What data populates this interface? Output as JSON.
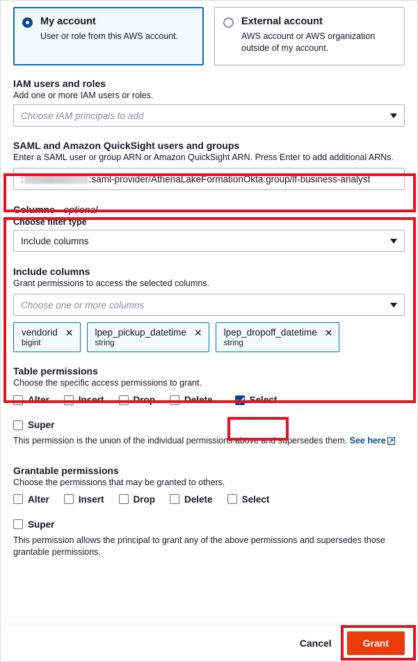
{
  "account_type": {
    "my_account": {
      "title": "My account",
      "description": "User or role from this AWS account.",
      "selected": true
    },
    "external_account": {
      "title": "External account",
      "description": "AWS account or AWS organization outside of my account.",
      "selected": false
    }
  },
  "iam": {
    "label": "IAM users and roles",
    "hint": "Add one or more IAM users or roles.",
    "placeholder": "Choose IAM principals to add"
  },
  "saml": {
    "label": "SAML and Amazon QuickSight users and groups",
    "hint": "Enter a SAML user or group ARN or Amazon QuickSight ARN. Press Enter to add additional ARNs.",
    "arn_prefix": ":",
    "arn_suffix": ":saml-provider/AthenaLakeFormationOkta:group/lf-business-analyst"
  },
  "columns": {
    "label": "Columns - ",
    "label_optional": "optional",
    "filter_type_label": "Choose filter type",
    "filter_type_value": "Include columns",
    "include_label": "Include columns",
    "include_hint": "Grant permissions to access the selected columns.",
    "include_placeholder": "Choose one or more columns",
    "chips": [
      {
        "name": "vendorid",
        "type": "bigint",
        "remove_icon": "✕"
      },
      {
        "name": "lpep_pickup_datetime",
        "type": "string",
        "remove_icon": "✕"
      },
      {
        "name": "lpep_dropoff_datetime",
        "type": "string",
        "remove_icon": "✕"
      }
    ]
  },
  "table_permissions": {
    "label": "Table permissions",
    "hint": "Choose the specific access permissions to grant.",
    "options": [
      {
        "label": "Alter",
        "checked": false
      },
      {
        "label": "Insert",
        "checked": false
      },
      {
        "label": "Drop",
        "checked": false
      },
      {
        "label": "Delete",
        "checked": false
      },
      {
        "label": "Select",
        "checked": true
      }
    ],
    "super": {
      "label": "Super",
      "checked": false
    },
    "super_note": "This permission is the union of the individual permissions above and supersedes them.",
    "super_link": "See here"
  },
  "grantable_permissions": {
    "label": "Grantable permissions",
    "hint": "Choose the permissions that may be granted to others.",
    "options": [
      {
        "label": "Alter",
        "checked": false
      },
      {
        "label": "Insert",
        "checked": false
      },
      {
        "label": "Drop",
        "checked": false
      },
      {
        "label": "Delete",
        "checked": false
      },
      {
        "label": "Select",
        "checked": false
      }
    ],
    "super": {
      "label": "Super",
      "checked": false
    },
    "super_note": "This permission allows the principal to grant any of the above permissions and supersedes those grantable permissions."
  },
  "footer": {
    "cancel_label": "Cancel",
    "grant_label": "Grant"
  },
  "colors": {
    "accent_blue": "#0073bb",
    "selected_bg": "#f1faff",
    "checkbox_blue": "#0a4a8f",
    "grant_orange": "#ec3c09",
    "highlight_red": "#e81123"
  }
}
